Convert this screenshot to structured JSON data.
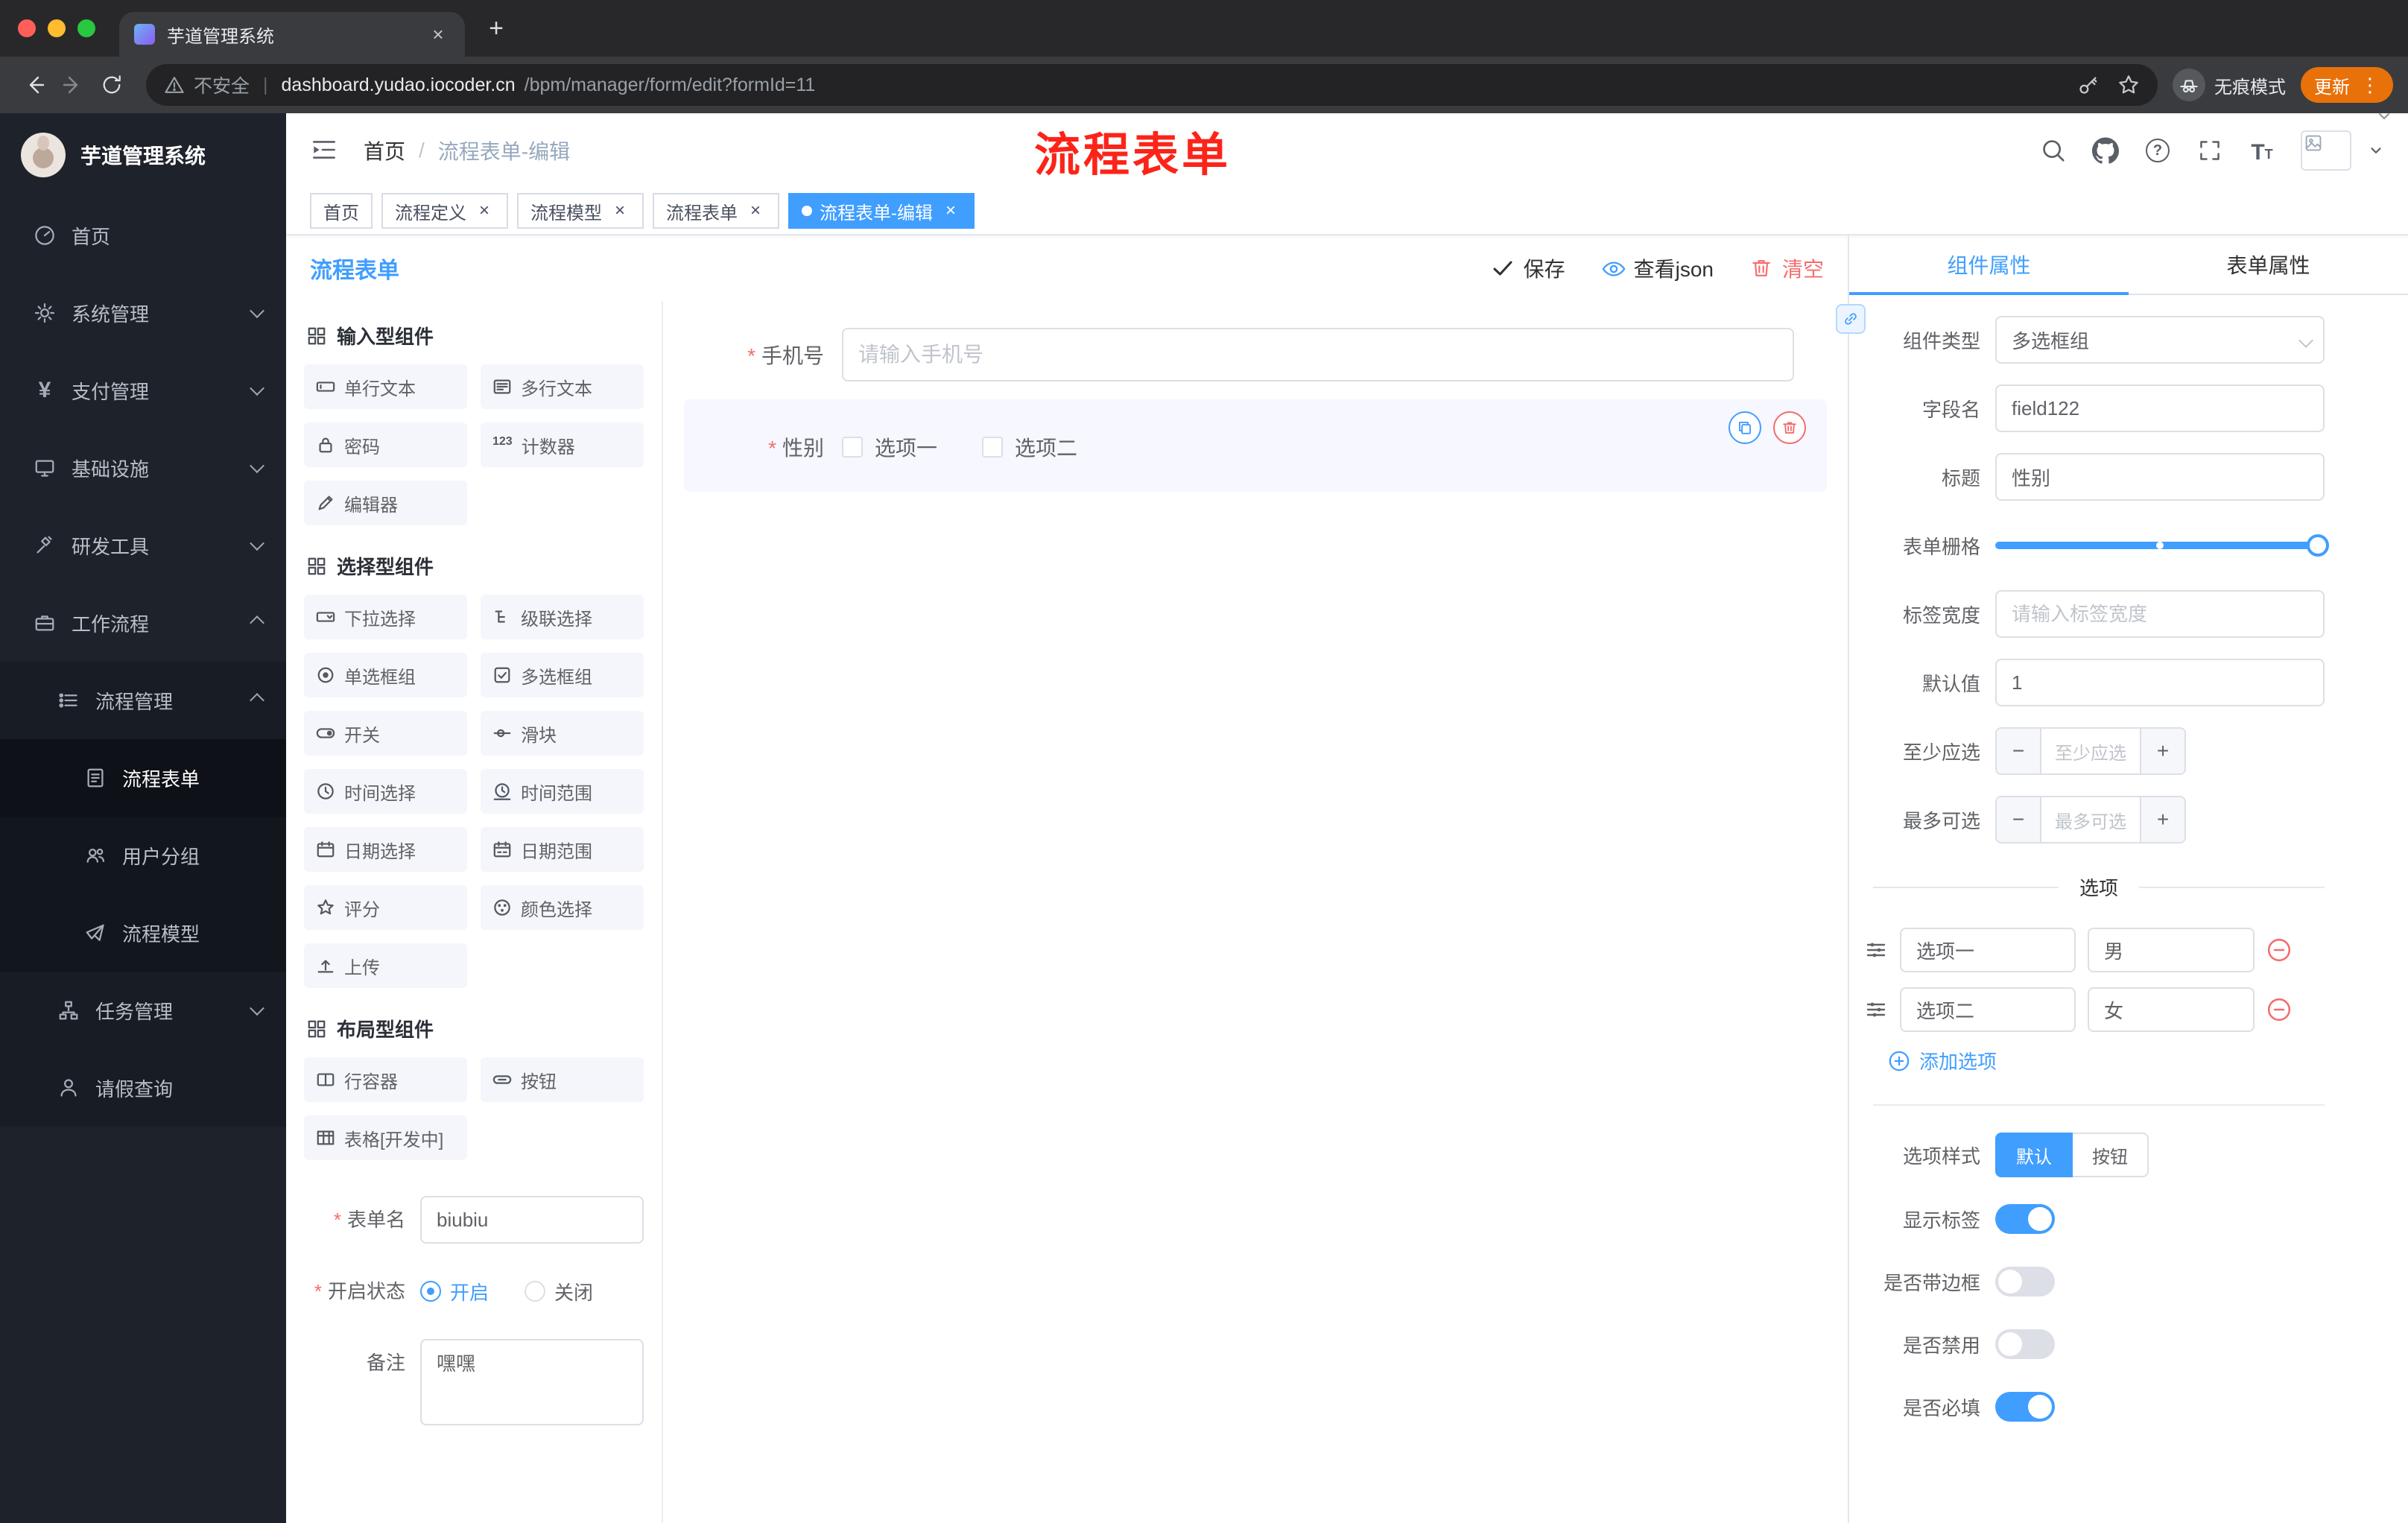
{
  "browser": {
    "tab_title": "芋道管理系统",
    "security_label": "不安全",
    "url_host": "dashboard.yudao.iocoder.cn",
    "url_path": "/bpm/manager/form/edit?formId=11",
    "incognito_label": "无痕模式",
    "update_label": "更新"
  },
  "icons": {
    "pipe": "|",
    "kebab": "⋮",
    "close": "×",
    "plus": "+",
    "minus": "−",
    "question": "?",
    "slash": "/",
    "yen": "¥",
    "counter": "123",
    "t_big": "T",
    "t_small": "T"
  },
  "sidebar": {
    "logo_title": "芋道管理系统",
    "menu": {
      "home": "首页",
      "system": "系统管理",
      "payment": "支付管理",
      "infra": "基础设施",
      "devtools": "研发工具",
      "workflow": "工作流程",
      "process_mgmt": "流程管理",
      "process_form": "流程表单",
      "user_group": "用户分组",
      "process_model": "流程模型",
      "task_mgmt": "任务管理",
      "leave_query": "请假查询"
    }
  },
  "header": {
    "breadcrumb_home": "首页",
    "breadcrumb_current": "流程表单-编辑",
    "annotation": "流程表单"
  },
  "tags": {
    "t1": "首页",
    "t2": "流程定义",
    "t3": "流程模型",
    "t4": "流程表单",
    "t5": "流程表单-编辑"
  },
  "designer": {
    "title": "流程表单",
    "save": "保存",
    "view_json": "查看json",
    "clear": "清空",
    "palette": {
      "s1": "输入型组件",
      "s1_items": {
        "i1": "单行文本",
        "i2": "多行文本",
        "i3": "密码",
        "i4": "计数器",
        "i5": "编辑器"
      },
      "s2": "选择型组件",
      "s2_items": {
        "i1": "下拉选择",
        "i2": "级联选择",
        "i3": "单选框组",
        "i4": "多选框组",
        "i5": "开关",
        "i6": "滑块",
        "i7": "时间选择",
        "i8": "时间范围",
        "i9": "日期选择",
        "i10": "日期范围",
        "i11": "评分",
        "i12": "颜色选择",
        "i13": "上传"
      },
      "s3": "布局型组件",
      "s3_items": {
        "i1": "行容器",
        "i2": "按钮",
        "i3": "表格[开发中]"
      }
    },
    "meta": {
      "form_name_label": "表单名",
      "form_name_value": "biubiu",
      "status_label": "开启状态",
      "status_on": "开启",
      "status_off": "关闭",
      "remark_label": "备注",
      "remark_value": "嘿嘿"
    },
    "canvas": {
      "phone_label": "手机号",
      "phone_placeholder": "请输入手机号",
      "gender_label": "性别",
      "gender_opt1": "选项一",
      "gender_opt2": "选项二"
    }
  },
  "props": {
    "tab_component": "组件属性",
    "tab_form": "表单属性",
    "component_type_label": "组件类型",
    "component_type_value": "多选框组",
    "field_name_label": "字段名",
    "field_name_value": "field122",
    "title_label": "标题",
    "title_value": "性别",
    "grid_label": "表单栅格",
    "label_width_label": "标签宽度",
    "label_width_placeholder": "请输入标签宽度",
    "default_label": "默认值",
    "default_value": "1",
    "min_label": "至少应选",
    "min_placeholder": "至少应选",
    "max_label": "最多可选",
    "max_placeholder": "最多可选",
    "options_divider": "选项",
    "opt1_label": "选项一",
    "opt1_value": "男",
    "opt2_label": "选项二",
    "opt2_value": "女",
    "add_option": "添加选项",
    "style_label": "选项样式",
    "style_default": "默认",
    "style_button": "按钮",
    "toggle_show_label": "显示标签",
    "toggle_border": "是否带边框",
    "toggle_disabled": "是否禁用",
    "toggle_required": "是否必填"
  },
  "colors": {
    "primary": "#409eff",
    "danger": "#f56c6c",
    "annotation_red": "#fc2419",
    "update_orange": "#e8710a",
    "sidebar_bg": "#1e222b",
    "active_component_bg": "#f6f7ff"
  }
}
